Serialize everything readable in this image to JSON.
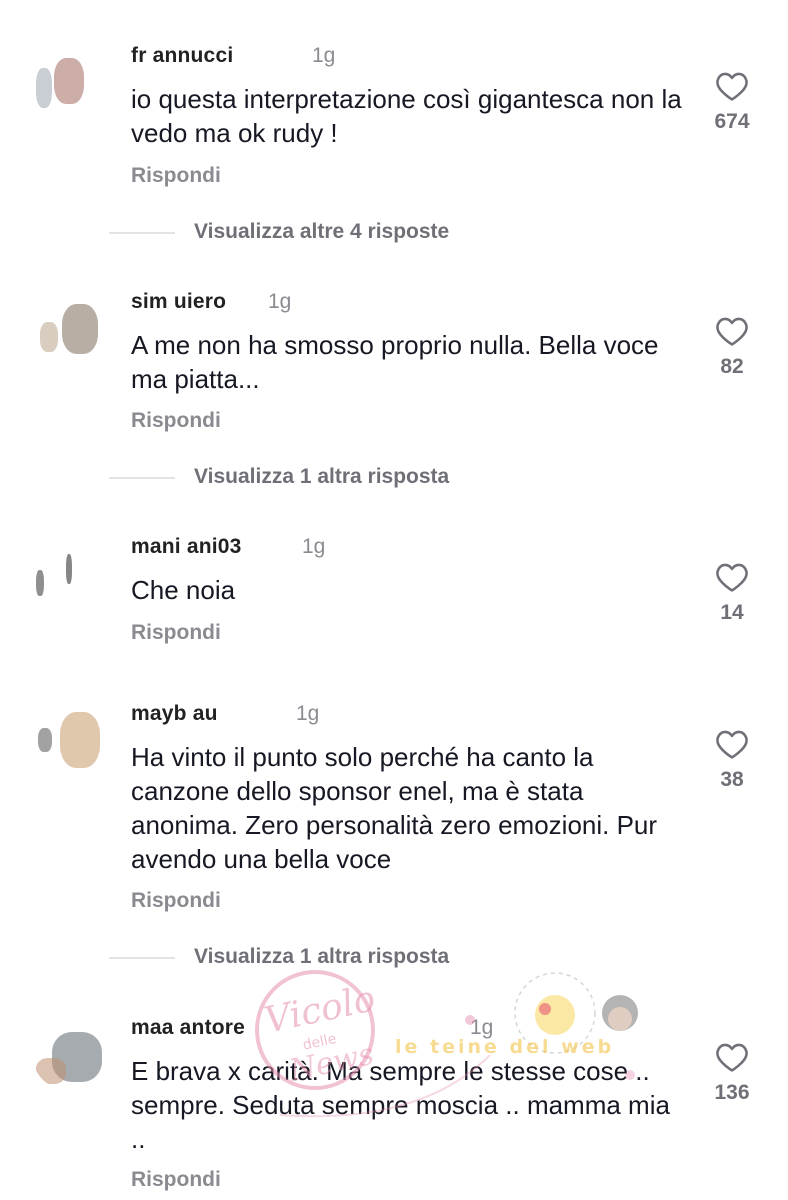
{
  "comments": [
    {
      "username": "fr            annucci",
      "time": "1g",
      "text": "io questa interpretazione così gigantesca non la vedo ma ok rudy !",
      "likes": "674",
      "reply_label": "Rispondi",
      "more_replies": "Visualizza altre 4 risposte"
    },
    {
      "username": "sim     uiero",
      "time": "1g",
      "text": "A me non ha smosso proprio nulla. Bella voce ma piatta...",
      "likes": "82",
      "reply_label": "Rispondi",
      "more_replies": "Visualizza 1 altra risposta"
    },
    {
      "username": "mani        ani03",
      "time": "1g",
      "text": "Che noia",
      "likes": "14",
      "reply_label": "Rispondi"
    },
    {
      "username": "mayb          au",
      "time": "1g",
      "text": "Ha vinto il punto solo perché ha canto la canzone dello sponsor enel, ma è stata anonima. Zero personalità zero emozioni. Pur avendo una bella voce",
      "likes": "38",
      "reply_label": "Rispondi",
      "more_replies": "Visualizza 1 altra risposta"
    },
    {
      "username": "maa                 antore",
      "time": "1g",
      "text": "E brava x carità. Ma sempre le stesse cose .. sempre. Seduta sempre moscia .. mamma mia ..",
      "likes": "136",
      "reply_label": "Rispondi"
    }
  ],
  "watermark": {
    "line1": "Vicolo",
    "line2": "delle",
    "line3": "News",
    "banner": "le teine del web"
  },
  "colors": {
    "text": "#161823",
    "muted": "#8a8b91",
    "heart": "#6f7077"
  },
  "icons": {
    "like": "heart-outline-icon"
  }
}
